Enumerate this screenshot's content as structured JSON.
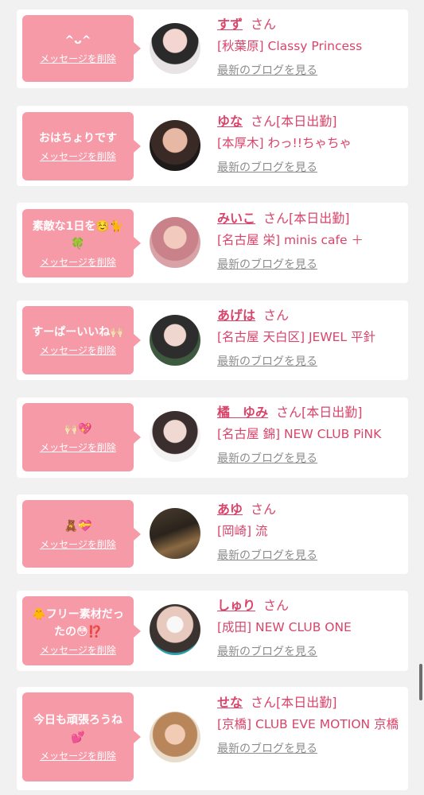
{
  "delete_label": "メッセージを削除",
  "blog_link_label": "最新のブログを見る",
  "san_suffix": "さん",
  "cards": [
    {
      "message": "^ᴗ^",
      "name": "すず",
      "status": "",
      "shop": "[秋葉原] Classy Princess"
    },
    {
      "message": "おはちょりです",
      "name": "ゆな",
      "status": "[本日出勤]",
      "shop": "[本厚木] わっ!!ちゃちゃ"
    },
    {
      "message": "素敵な1日を☺️🐈🍀",
      "name": "みいこ",
      "status": "[本日出勤]",
      "shop": "[名古屋 栄] minis cafe ＋"
    },
    {
      "message": "すーぱーいいね🙌🏻",
      "name": "あげは",
      "status": "",
      "shop": "[名古屋 天白区] JEWEL 平針"
    },
    {
      "message": "🙌🏻💖",
      "name": "橘　ゆみ",
      "status": "[本日出勤]",
      "shop": "[名古屋 錦] NEW CLUB PiNK"
    },
    {
      "message": "🧸💝",
      "name": "あゆ",
      "status": "",
      "shop": "[岡崎] 流"
    },
    {
      "message": "🐥フリー素材だったの😳⁉️",
      "name": "しゅり",
      "status": "",
      "shop": "[成田] NEW CLUB ONE"
    },
    {
      "message": "今日も頑張ろうね💕",
      "name": "せな",
      "status": "[本日出勤]",
      "shop": "[京橋] CLUB EVE MOTION 京橋"
    }
  ]
}
